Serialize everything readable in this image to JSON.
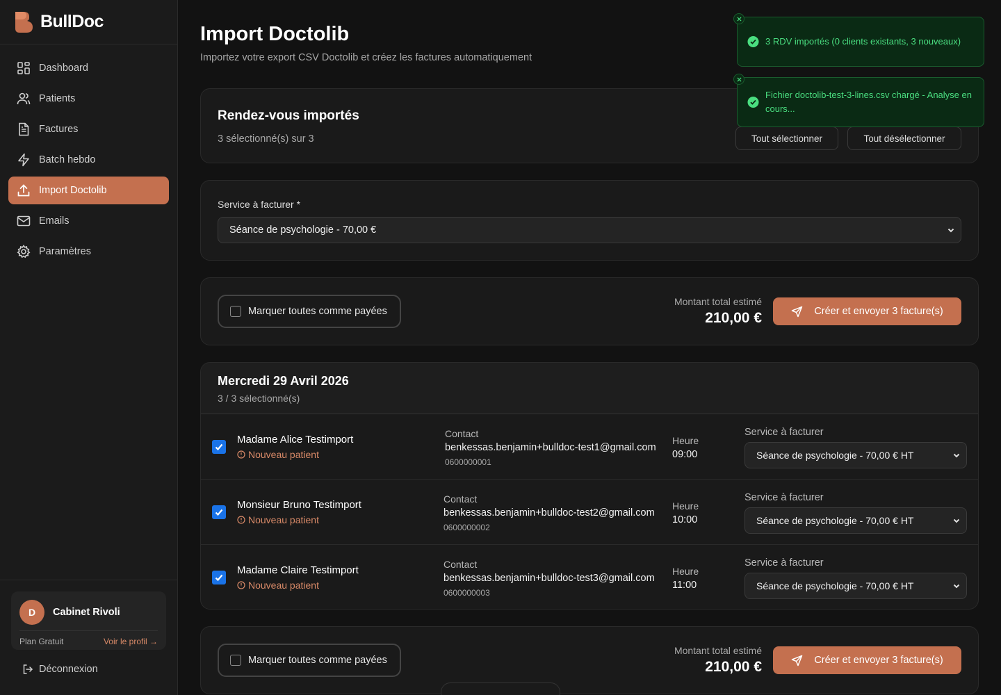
{
  "brand": {
    "name": "BullDoc",
    "accent": "#c4704f"
  },
  "sidebar": {
    "items": [
      {
        "label": "Dashboard",
        "icon": "grid-icon"
      },
      {
        "label": "Patients",
        "icon": "users-icon"
      },
      {
        "label": "Factures",
        "icon": "file-icon"
      },
      {
        "label": "Batch hebdo",
        "icon": "zap-icon"
      },
      {
        "label": "Import Doctolib",
        "icon": "upload-icon",
        "active": true
      },
      {
        "label": "Emails",
        "icon": "mail-icon"
      },
      {
        "label": "Paramètres",
        "icon": "gear-icon"
      }
    ],
    "profile": {
      "initial": "D",
      "name": "Cabinet Rivoli",
      "plan": "Plan Gratuit",
      "link": "Voir le profil →"
    },
    "logout": "Déconnexion"
  },
  "page": {
    "title": "Import Doctolib",
    "subtitle": "Importez votre export CSV Doctolib et créez les factures automatiquement"
  },
  "imported": {
    "title": "Rendez-vous importés",
    "count": "3 sélectionné(s) sur 3",
    "select_all": "Tout sélectionner",
    "deselect_all": "Tout désélectionner"
  },
  "service": {
    "label": "Service à facturer *",
    "value": "Séance de psychologie - 70,00 €"
  },
  "actions": {
    "mark_paid": "Marquer toutes comme payées",
    "total_label": "Montant total estimé",
    "total_value": "210,00 €",
    "create_button": "Créer et envoyer 3 facture(s)"
  },
  "day": {
    "title": "Mercredi 29 Avril 2026",
    "count": "3 / 3 sélectionné(s)",
    "contact_label": "Contact",
    "time_label": "Heure",
    "service_label": "Service à facturer",
    "rows": [
      {
        "name": "Madame Alice Testimport",
        "status": "Nouveau patient",
        "email": "benkessas.benjamin+bulldoc-test1@gmail.com",
        "phone": "0600000001",
        "time": "09:00",
        "service": "Séance de psychologie - 70,00 € HT",
        "checked": true
      },
      {
        "name": "Monsieur Bruno Testimport",
        "status": "Nouveau patient",
        "email": "benkessas.benjamin+bulldoc-test2@gmail.com",
        "phone": "0600000002",
        "time": "10:00",
        "service": "Séance de psychologie - 70,00 € HT",
        "checked": true
      },
      {
        "name": "Madame Claire Testimport",
        "status": "Nouveau patient",
        "email": "benkessas.benjamin+bulldoc-test3@gmail.com",
        "phone": "0600000003",
        "time": "11:00",
        "service": "Séance de psychologie - 70,00 € HT",
        "checked": true
      }
    ]
  },
  "toasts": [
    {
      "text": "3 RDV importés (0 clients existants, 3 nouveaux)",
      "color": "#4ade80"
    },
    {
      "text": "Fichier doctolib-test-3-lines.csv chargé - Analyse en cours...",
      "color": "#4ade80"
    }
  ]
}
